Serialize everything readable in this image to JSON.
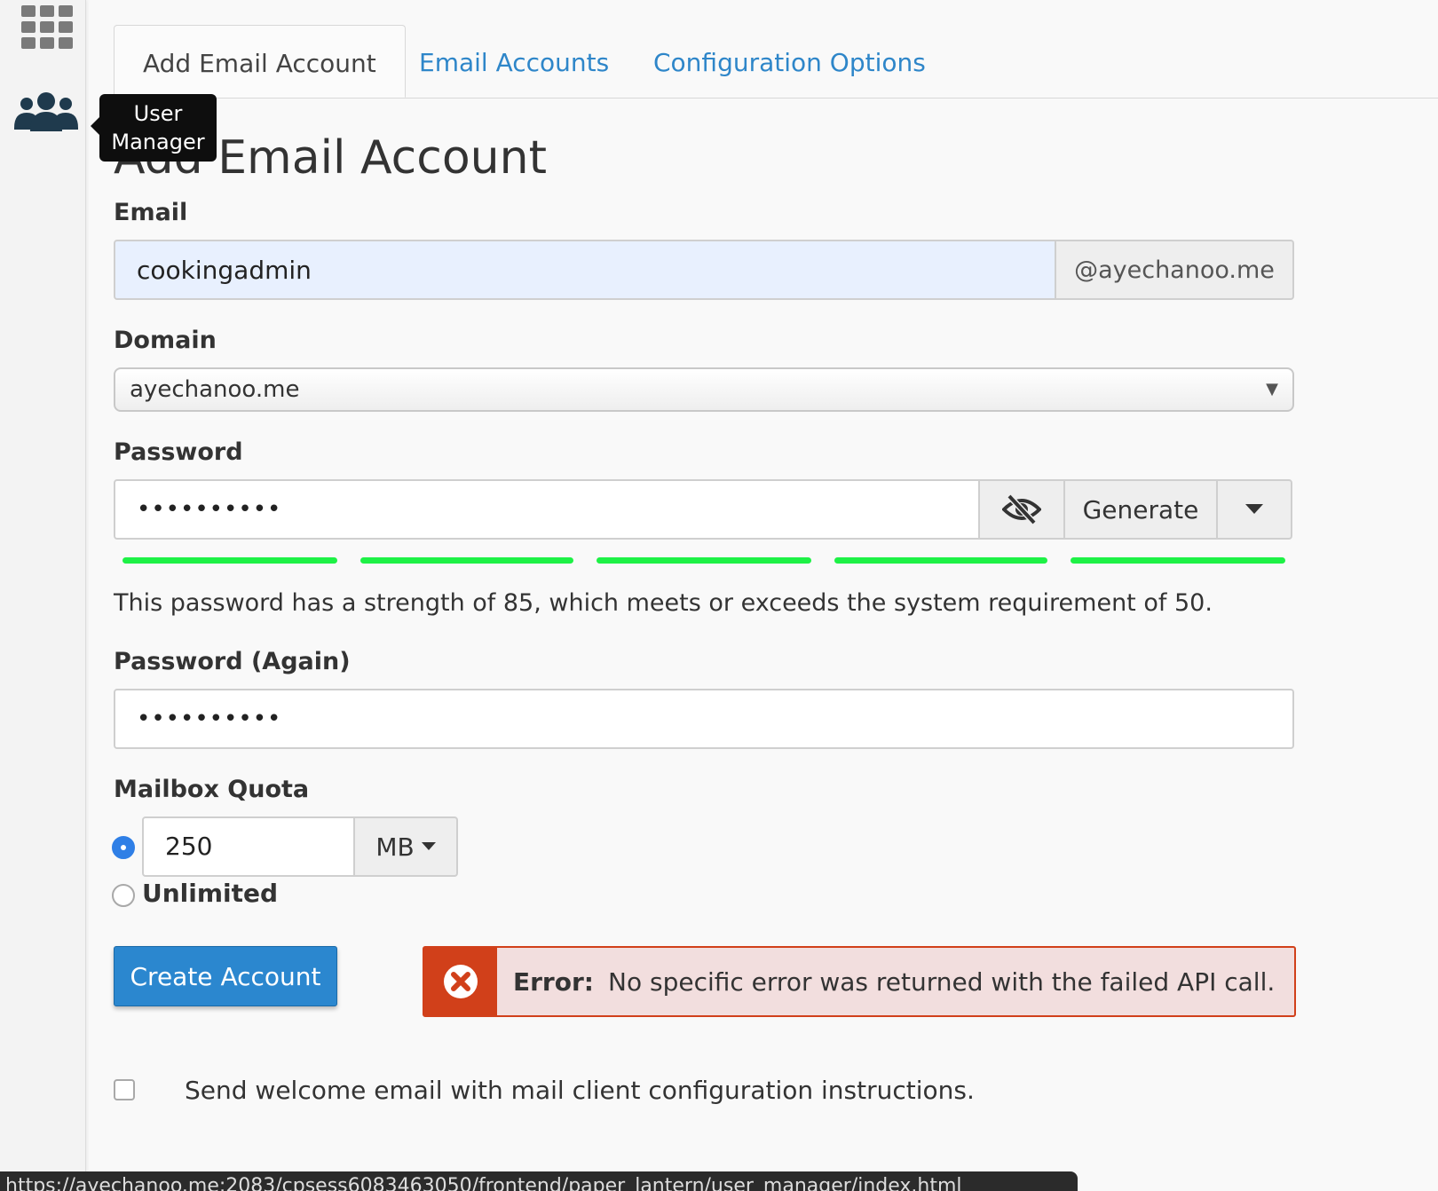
{
  "tabs": [
    {
      "label": "Add Email Account",
      "active": true
    },
    {
      "label": "Email Accounts",
      "active": false
    },
    {
      "label": "Configuration Options",
      "active": false
    }
  ],
  "sidebar": {
    "icons": [
      "grid-icon",
      "users-icon"
    ],
    "tooltip": "User Manager"
  },
  "page": {
    "title": "Add Email Account"
  },
  "form": {
    "email": {
      "label": "Email",
      "value": "cookingadmin",
      "domain_suffix": "@ayechanoo.me"
    },
    "domain": {
      "label": "Domain",
      "selected": "ayechanoo.me"
    },
    "password": {
      "label": "Password",
      "masked_value": "••••••••••",
      "generate_label": "Generate",
      "strength_segments_filled": 5,
      "strength_segments_total": 5,
      "strength_text": "This password has a strength of 85, which meets or exceeds the system requirement of 50.",
      "strength_color": "#1ef146"
    },
    "password_again": {
      "label": "Password (Again)",
      "masked_value": "••••••••••"
    },
    "quota": {
      "label": "Mailbox Quota",
      "value": "250",
      "unit": "MB",
      "unlimited_label": "Unlimited",
      "selected": "limited"
    },
    "create_button": "Create Account",
    "error": {
      "title": "Error:",
      "message": "No specific error was returned with the failed API call.",
      "color": "#d1401a"
    },
    "welcome_email": {
      "label": "Send welcome email with mail client configuration instructions.",
      "checked": false
    }
  },
  "status_bar": {
    "url": "https://ayechanoo.me:2083/cpsess6083463050/frontend/paper_lantern/user_manager/index.html"
  },
  "colors": {
    "accent": "#2b87cf",
    "link": "#2e86c9",
    "error": "#d1401a"
  }
}
